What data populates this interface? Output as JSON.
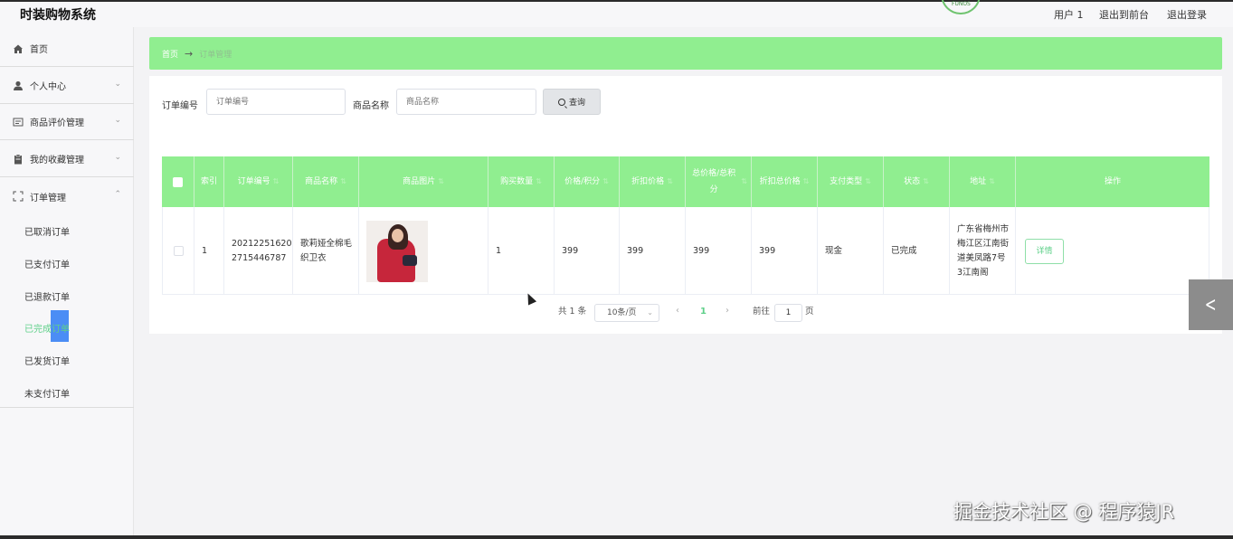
{
  "header": {
    "app_title": "时装购物系统",
    "user_label": "用户 1",
    "back_to_front": "退出到前台",
    "logout": "退出登录"
  },
  "sidebar": {
    "items": [
      {
        "label": "首页",
        "icon": "home-icon"
      },
      {
        "label": "个人中心",
        "icon": "user-icon"
      },
      {
        "label": "商品评价管理",
        "icon": "review-icon"
      },
      {
        "label": "我的收藏管理",
        "icon": "clipboard-icon"
      },
      {
        "label": "订单管理",
        "icon": "order-icon"
      }
    ],
    "submenu": [
      "已取消订单",
      "已支付订单",
      "已退款订单",
      "已完成订单",
      "已发货订单",
      "未支付订单"
    ],
    "active_submenu": "已完成订单"
  },
  "breadcrumb": {
    "home": "首页",
    "arrow": "→",
    "current": "订单管理"
  },
  "search": {
    "order_no_label": "订单编号",
    "order_no_placeholder": "订单编号",
    "product_name_label": "商品名称",
    "product_name_placeholder": "商品名称",
    "query_button": "查询"
  },
  "table": {
    "headers": [
      "",
      "索引",
      "订单编号",
      "商品名称",
      "商品图片",
      "购买数量",
      "价格/积分",
      "折扣价格",
      "总价格/总积分",
      "折扣总价格",
      "支付类型",
      "状态",
      "地址",
      "操作"
    ],
    "rows": [
      {
        "index": "1",
        "order_no": "202122516202715446787",
        "product_name": "歌莉娅全棉毛织卫衣",
        "quantity": "1",
        "price": "399",
        "discount_price": "399",
        "total_price": "399",
        "discount_total": "399",
        "pay_type": "现金",
        "status": "已完成",
        "address": "广东省梅州市梅江区江南街道美凤路7号3江南阁",
        "action": "详情"
      }
    ]
  },
  "pagination": {
    "total": "共 1 条",
    "page_size": "10条/页",
    "prev": "‹",
    "current_page": "1",
    "next": "›",
    "goto_label": "前往",
    "goto_value": "1",
    "page_unit": "页"
  },
  "watermark": "掘金技术社区 @ 程序猿JR",
  "colors": {
    "accent": "#90ee90",
    "active_text": "#5fd08a",
    "highlight": "#4b8df5"
  }
}
